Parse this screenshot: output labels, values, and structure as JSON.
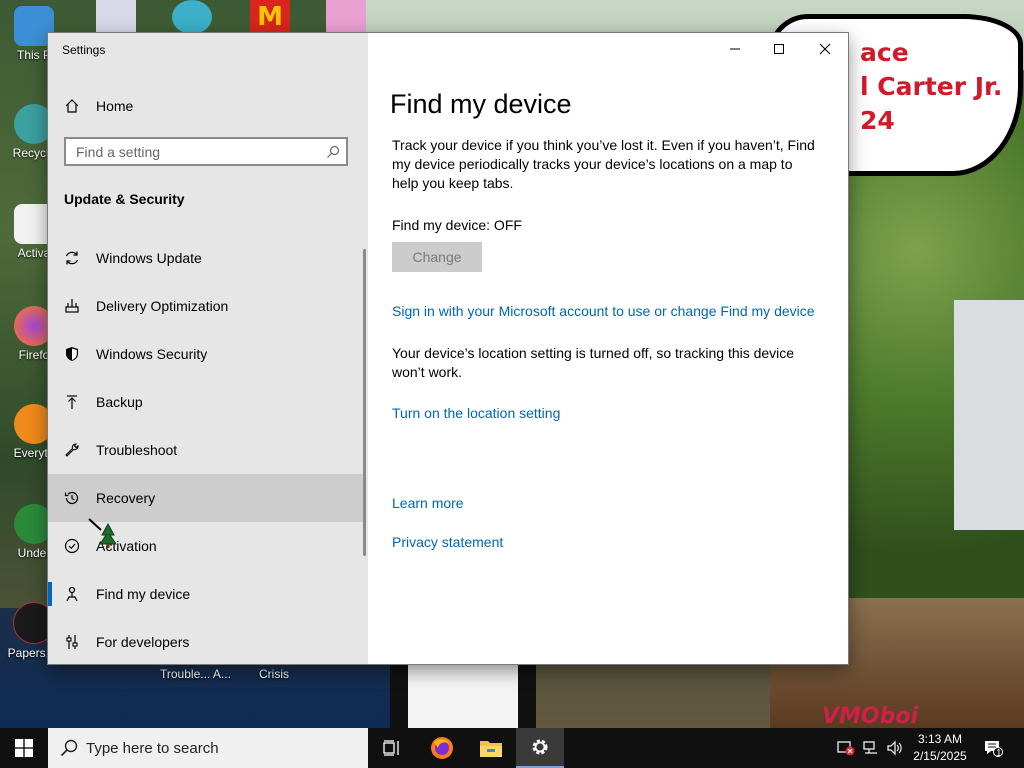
{
  "desktop": {
    "icons": [
      {
        "label": "This P",
        "name": "this-pc"
      },
      {
        "label": "Recycle",
        "name": "recycle-bin"
      },
      {
        "label": "Activa",
        "name": "activate"
      },
      {
        "label": "Firefo",
        "name": "firefox"
      },
      {
        "label": "Everyth",
        "name": "everything"
      },
      {
        "label": "Under",
        "name": "undertale"
      },
      {
        "label": "Papers, P",
        "name": "papers-please"
      }
    ],
    "bottom_labels": [
      "Trouble... A...",
      "Crisis"
    ],
    "bubble_lines": [
      "ace",
      "l Carter Jr.",
      "24"
    ],
    "watermark": "VMOboi"
  },
  "window": {
    "title": "Settings",
    "controls": {
      "minimize": "minimize",
      "maximize": "maximize",
      "close": "close"
    }
  },
  "sidebar": {
    "home_label": "Home",
    "search_placeholder": "Find a setting",
    "section_title": "Update & Security",
    "items": [
      {
        "label": "Windows Update",
        "icon": "refresh-icon"
      },
      {
        "label": "Delivery Optimization",
        "icon": "delivery-icon"
      },
      {
        "label": "Windows Security",
        "icon": "shield-icon"
      },
      {
        "label": "Backup",
        "icon": "backup-arrow-icon"
      },
      {
        "label": "Troubleshoot",
        "icon": "wrench-icon"
      },
      {
        "label": "Recovery",
        "icon": "history-icon"
      },
      {
        "label": "Activation",
        "icon": "check-circle-icon"
      },
      {
        "label": "Find my device",
        "icon": "person-pin-icon"
      },
      {
        "label": "For developers",
        "icon": "sliders-icon"
      }
    ],
    "hover_index": 5,
    "active_index": 7
  },
  "main": {
    "title": "Find my device",
    "description": "Track your device if you think you’ve lost it. Even if you haven’t, Find my device periodically tracks your device’s locations on a map to help you keep tabs.",
    "status": "Find my device: OFF",
    "change_button": "Change",
    "signin_link": "Sign in with your Microsoft account to use or change Find my device",
    "location_note": "Your device’s location setting is turned off, so tracking this device won’t work.",
    "location_link": "Turn on the location setting",
    "learn_more": "Learn more",
    "privacy": "Privacy statement"
  },
  "taskbar": {
    "search_placeholder": "Type here to search",
    "time": "3:13 AM",
    "date": "2/15/2025",
    "notification_count": "1"
  }
}
